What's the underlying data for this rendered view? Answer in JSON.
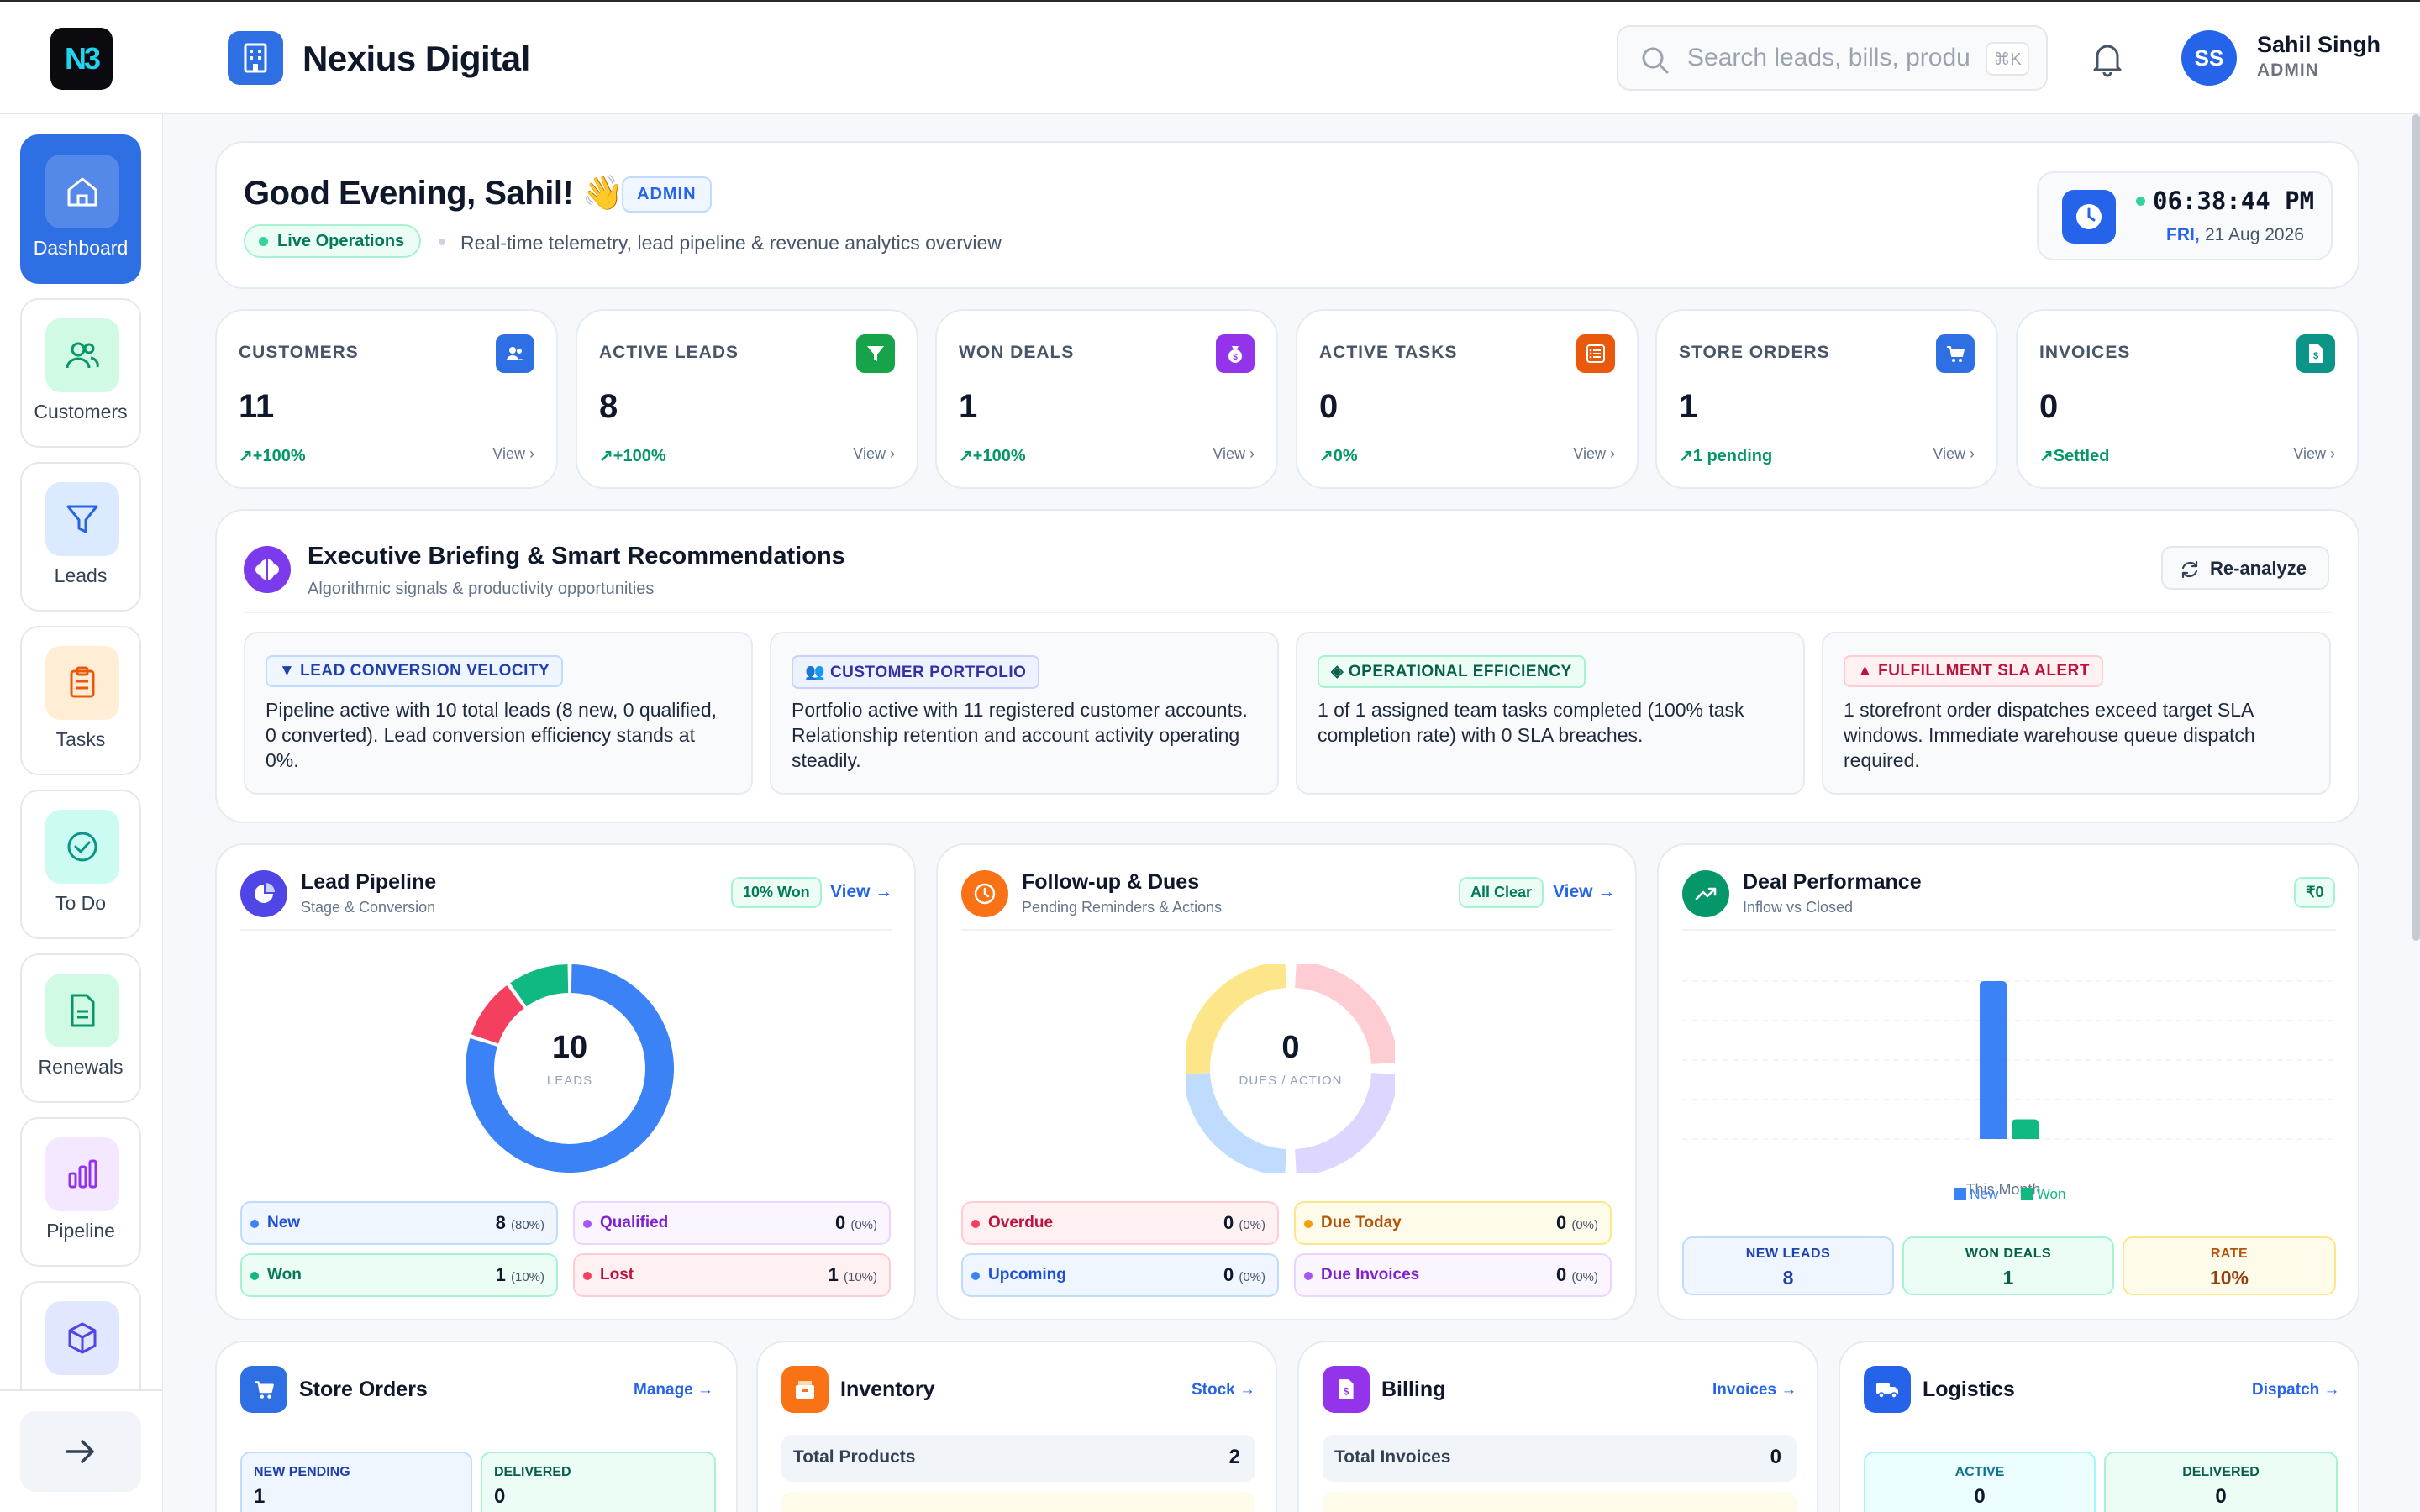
{
  "header": {
    "logo_text": "N3",
    "brand": "Nexius Digital",
    "search_placeholder": "Search leads, bills, produ",
    "search_shortcut": "⌘K",
    "user_initials": "SS",
    "user_name": "Sahil Singh",
    "user_role": "ADMIN"
  },
  "sidebar": {
    "items": [
      {
        "label": "Dashboard"
      },
      {
        "label": "Customers"
      },
      {
        "label": "Leads"
      },
      {
        "label": "Tasks"
      },
      {
        "label": "To Do"
      },
      {
        "label": "Renewals"
      },
      {
        "label": "Pipeline"
      }
    ]
  },
  "welcome": {
    "greeting": "Good Evening, Sahil! 👋",
    "role_badge": "ADMIN",
    "live": "Live Operations",
    "subtitle": "Real-time telemetry, lead pipeline & revenue analytics overview",
    "time": "06:38:44 PM",
    "day": "FRI,",
    "date": "21 Aug 2026"
  },
  "kpis": [
    {
      "title": "CUSTOMERS",
      "value": "11",
      "delta": "+100%",
      "link": "View"
    },
    {
      "title": "ACTIVE LEADS",
      "value": "8",
      "delta": "+100%",
      "link": "View"
    },
    {
      "title": "WON DEALS",
      "value": "1",
      "delta": "+100%",
      "link": "View"
    },
    {
      "title": "ACTIVE TASKS",
      "value": "0",
      "delta": "0%",
      "link": "View"
    },
    {
      "title": "STORE ORDERS",
      "value": "1",
      "delta": "1 pending",
      "link": "View"
    },
    {
      "title": "INVOICES",
      "value": "0",
      "delta": "Settled",
      "link": "View"
    }
  ],
  "briefing": {
    "title": "Executive Briefing & Smart Recommendations",
    "subtitle": "Algorithmic signals & productivity opportunities",
    "action": "Re-analyze",
    "cards": [
      {
        "tag": "LEAD CONVERSION VELOCITY",
        "text": "Pipeline active with 10 total leads (8 new, 0 qualified, 0 converted). Lead conversion efficiency stands at 0%."
      },
      {
        "tag": "CUSTOMER PORTFOLIO",
        "text": "Portfolio active with 11 registered customer accounts. Relationship retention and account activity operating steadily."
      },
      {
        "tag": "OPERATIONAL EFFICIENCY",
        "text": "1 of 1 assigned team tasks completed (100% task completion rate) with 0 SLA breaches."
      },
      {
        "tag": "FULFILLMENT SLA ALERT",
        "text": "1 storefront order dispatches exceed target SLA windows. Immediate warehouse queue dispatch required."
      }
    ]
  },
  "pipeline": {
    "title": "Lead Pipeline",
    "subtitle": "Stage & Conversion",
    "badge": "10% Won",
    "link": "View →",
    "center_value": "10",
    "center_label": "LEADS",
    "legend": [
      {
        "name": "New",
        "count": "8",
        "pct": "(80%)"
      },
      {
        "name": "Qualified",
        "count": "0",
        "pct": "(0%)"
      },
      {
        "name": "Won",
        "count": "1",
        "pct": "(10%)"
      },
      {
        "name": "Lost",
        "count": "1",
        "pct": "(10%)"
      }
    ],
    "segments": [
      {
        "value": 8,
        "color": "#3b82f6"
      },
      {
        "value": 1,
        "color": "#f43f5e"
      },
      {
        "value": 1,
        "color": "#10b981"
      }
    ]
  },
  "followup": {
    "title": "Follow-up & Dues",
    "subtitle": "Pending Reminders & Actions",
    "badge": "All Clear",
    "link": "View →",
    "center_value": "0",
    "center_label": "DUES / ACTION",
    "legend": [
      {
        "name": "Overdue",
        "count": "0",
        "pct": "(0%)"
      },
      {
        "name": "Due Today",
        "count": "0",
        "pct": "(0%)"
      },
      {
        "name": "Upcoming",
        "count": "0",
        "pct": "(0%)"
      },
      {
        "name": "Due Invoices",
        "count": "0",
        "pct": "(0%)"
      }
    ]
  },
  "deals": {
    "title": "Deal Performance",
    "subtitle": "Inflow vs Closed",
    "badge": "₹0",
    "stats": [
      {
        "label": "NEW LEADS",
        "value": "8"
      },
      {
        "label": "WON DEALS",
        "value": "1"
      },
      {
        "label": "RATE",
        "value": "10%"
      }
    ]
  },
  "chart_data": {
    "type": "bar",
    "categories": [
      "This Month"
    ],
    "series": [
      {
        "name": "New",
        "values": [
          8
        ],
        "color": "#3b82f6"
      },
      {
        "name": "Won",
        "values": [
          1
        ],
        "color": "#10b981"
      }
    ],
    "ylim": [
      0,
      8
    ],
    "legend": "bottom",
    "grid": true
  },
  "bottom": {
    "store": {
      "title": "Store Orders",
      "link": "Manage →",
      "pending_label": "NEW PENDING",
      "pending_value": "1",
      "delivered_label": "DELIVERED",
      "delivered_value": "0"
    },
    "inventory": {
      "title": "Inventory",
      "link": "Stock →",
      "row_label": "Total Products",
      "row_value": "2"
    },
    "billing": {
      "title": "Billing",
      "link": "Invoices →",
      "row_label": "Total Invoices",
      "row_value": "0"
    },
    "logistics": {
      "title": "Logistics",
      "link": "Dispatch →",
      "active_label": "ACTIVE",
      "active_value": "0",
      "delivered_label": "DELIVERED",
      "delivered_value": "0"
    }
  },
  "colors": {
    "accent": "#2f6fe4",
    "success": "#059669",
    "danger": "#e11d48"
  }
}
